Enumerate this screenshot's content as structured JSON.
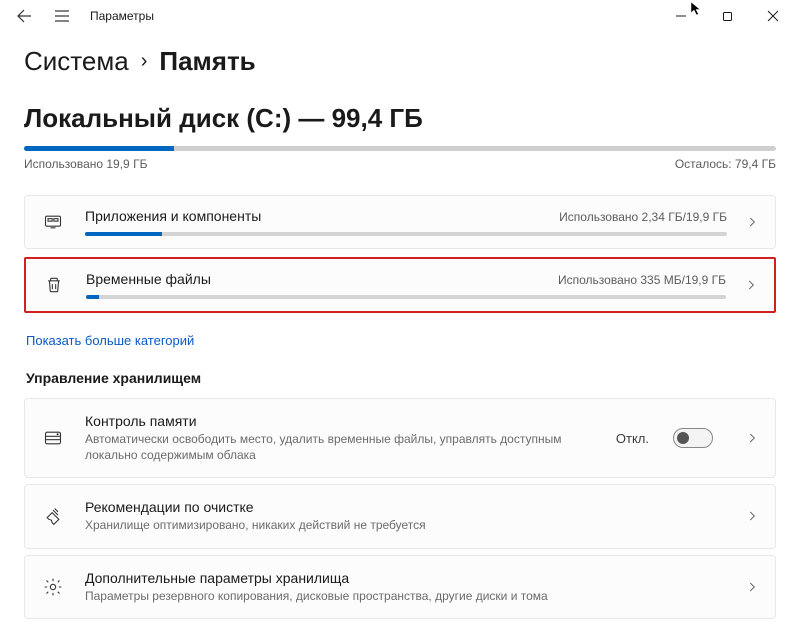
{
  "titlebar": {
    "app_title": "Параметры"
  },
  "breadcrumb": {
    "system": "Система",
    "chevron": "›",
    "current": "Память"
  },
  "disk": {
    "title": "Локальный диск (C:) — 99,4 ГБ",
    "used_label": "Использовано 19,9 ГБ",
    "free_label": "Осталось: 79,4 ГБ",
    "used_pct": 20
  },
  "categories": [
    {
      "icon": "apps",
      "title": "Приложения и компоненты",
      "usage": "Использовано 2,34 ГБ/19,9 ГБ",
      "fill_pct": 12,
      "highlight": false
    },
    {
      "icon": "trash",
      "title": "Временные файлы",
      "usage": "Использовано 335 МБ/19,9 ГБ",
      "fill_pct": 2,
      "highlight": true
    }
  ],
  "more_link": "Показать больше категорий",
  "section_header": "Управление хранилищем",
  "management": [
    {
      "icon": "disk",
      "title": "Контроль памяти",
      "subtitle": "Автоматически освободить место, удалить временные файлы, управлять доступным локально содержимым облака",
      "toggle": {
        "label": "Откл.",
        "on": false
      }
    },
    {
      "icon": "broom",
      "title": "Рекомендации по очистке",
      "subtitle": "Хранилище оптимизировано, никаких действий не требуется"
    },
    {
      "icon": "gear",
      "title": "Дополнительные параметры хранилища",
      "subtitle": "Параметры резервного копирования, дисковые пространства, другие диски и тома"
    }
  ]
}
